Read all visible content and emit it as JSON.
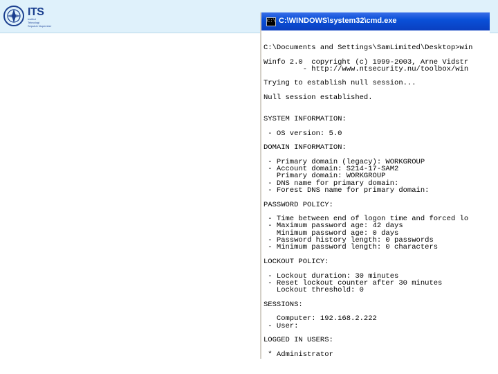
{
  "header": {
    "logo_text": "ITS",
    "subtitle": "Institut\nTeknologi\nSepuluh Nopember"
  },
  "window": {
    "title": "C:\\WINDOWS\\system32\\cmd.exe",
    "icon": "cmd-icon",
    "icon_text": "C:\\"
  },
  "console_lines": [
    "C:\\Documents and Settings\\SamLimited\\Desktop>win",
    "",
    "Winfo 2.0  copyright (c) 1999-2003, Arne Vidstr",
    "         - http://www.ntsecurity.nu/toolbox/win",
    "",
    "Trying to establish null session...",
    "",
    "Null session established.",
    "",
    "",
    "SYSTEM INFORMATION:",
    "",
    " - OS version: 5.0",
    "",
    "DOMAIN INFORMATION:",
    "",
    " - Primary domain (legacy): WORKGROUP",
    " - Account domain: S214-17-SAM2",
    "   Primary domain: WORKGROUP",
    " - DNS name for primary domain:",
    " - Forest DNS name for primary domain:",
    "",
    "PASSWORD POLICY:",
    "",
    " - Time between end of logon time and forced lo",
    " - Maximum password age: 42 days",
    "   Minimum password age: 0 days",
    " - Password history length: 0 passwords",
    " - Minimum password length: 0 characters",
    "",
    "LOCKOUT POLICY:",
    "",
    " - Lockout duration: 30 minutes",
    " - Reset lockout counter after 30 minutes",
    "   Lockout threshold: 0",
    "",
    "SESSIONS:",
    "",
    "   Computer: 192.168.2.222",
    " - User:",
    "",
    "LOGGED IN USERS:",
    "",
    " * Administrator"
  ]
}
